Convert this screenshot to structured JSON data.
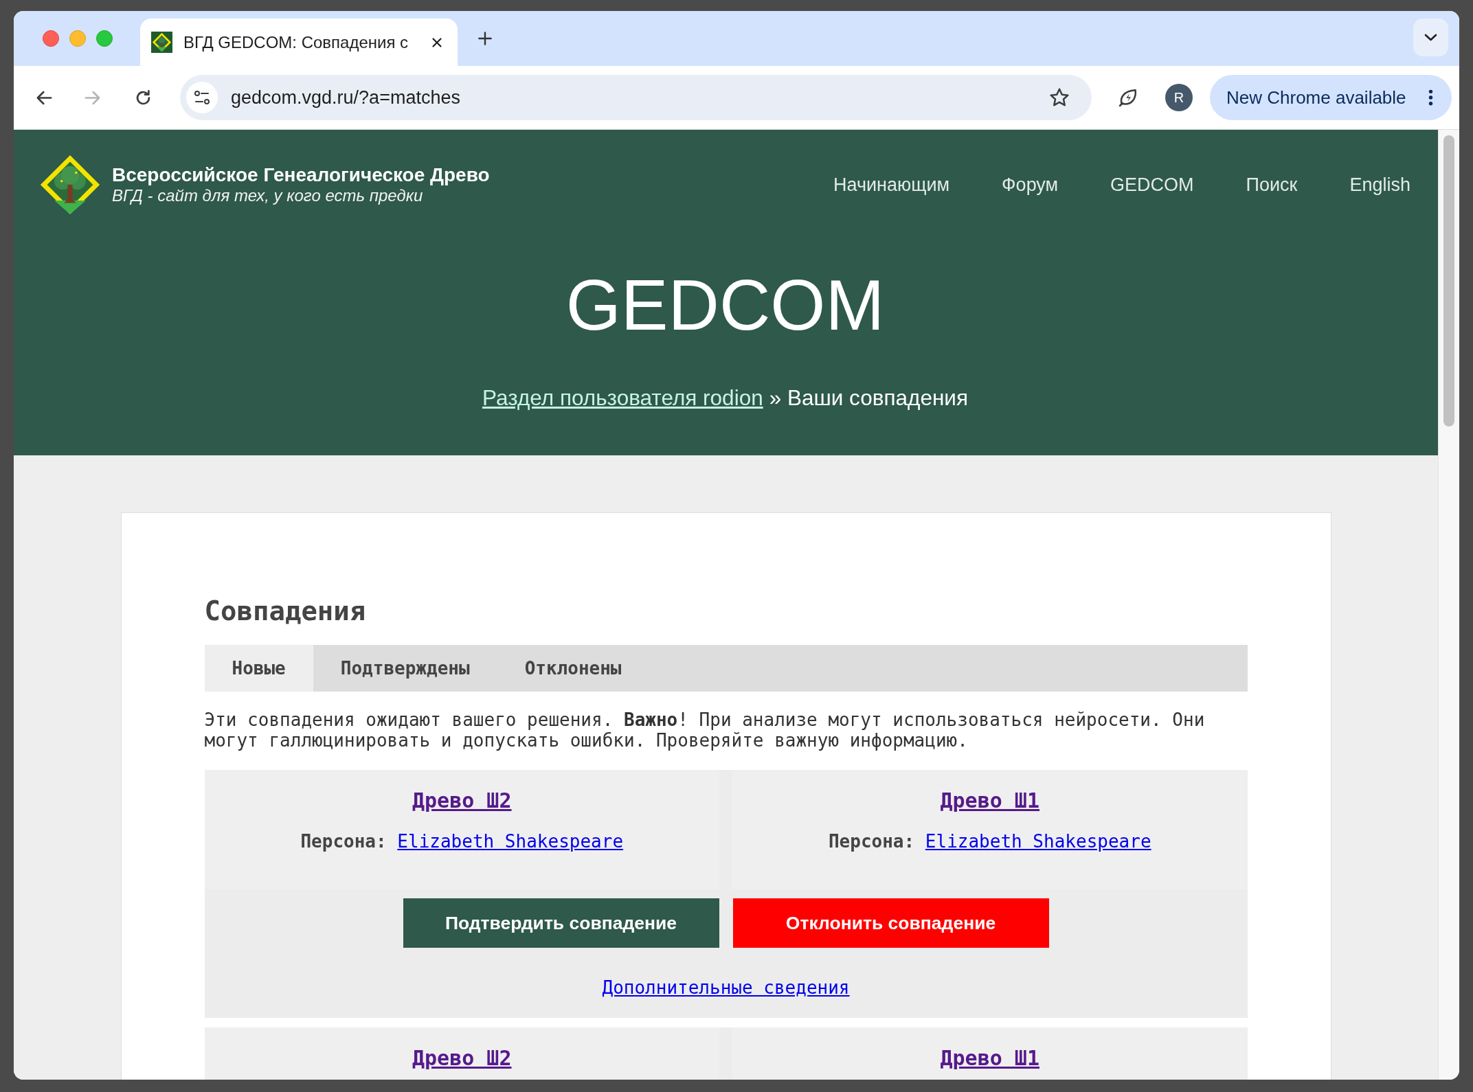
{
  "browser": {
    "tab_title": "ВГД GEDCOM: Совпадения с",
    "back_disabled": false,
    "forward_disabled": true,
    "url": "gedcom.vgd.ru/?a=matches",
    "profile_initial": "R",
    "update_button": "New Chrome available"
  },
  "site_header": {
    "title": "Всероссийское Генеалогическое Древо",
    "tagline": "ВГД - сайт для тех, у кого есть предки",
    "nav": [
      "Начинающим",
      "Форум",
      "GEDCOM",
      "Поиск",
      "English"
    ]
  },
  "hero": {
    "title": "GEDCOM",
    "breadcrumb_link": "Раздел пользователя rodion",
    "breadcrumb_current": "» Ваши совпадения"
  },
  "matches_panel": {
    "heading": "Совпадения",
    "tabs": [
      {
        "label": "Новые",
        "selected": true
      },
      {
        "label": "Подтверждены",
        "selected": false
      },
      {
        "label": "Отклонены",
        "selected": false
      }
    ],
    "notice": "Эти совпадения ожидают вашего решения. **Важно**! При анализе могут использоваться нейросети. Они могут галлюцинировать и допускать ошибки. Проверяйте важную информацию.",
    "matches": [
      {
        "sides": [
          {
            "tree": "Древо Ш2",
            "persona_label": "Персона:",
            "persona": "Elizabeth Shakespeare"
          },
          {
            "tree": "Древо Ш1",
            "persona_label": "Персона:",
            "persona": "Elizabeth Shakespeare"
          }
        ],
        "actions": [
          {
            "label": "Подтвердить совпадение",
            "kind": "confirm"
          },
          {
            "label": "Отклонить совпадение",
            "kind": "reject"
          }
        ],
        "details_link": "Дополнительные сведения"
      },
      {
        "sides": [
          {
            "tree": "Древо Ш2"
          },
          {
            "tree": "Древо Ш1"
          }
        ]
      }
    ]
  }
}
